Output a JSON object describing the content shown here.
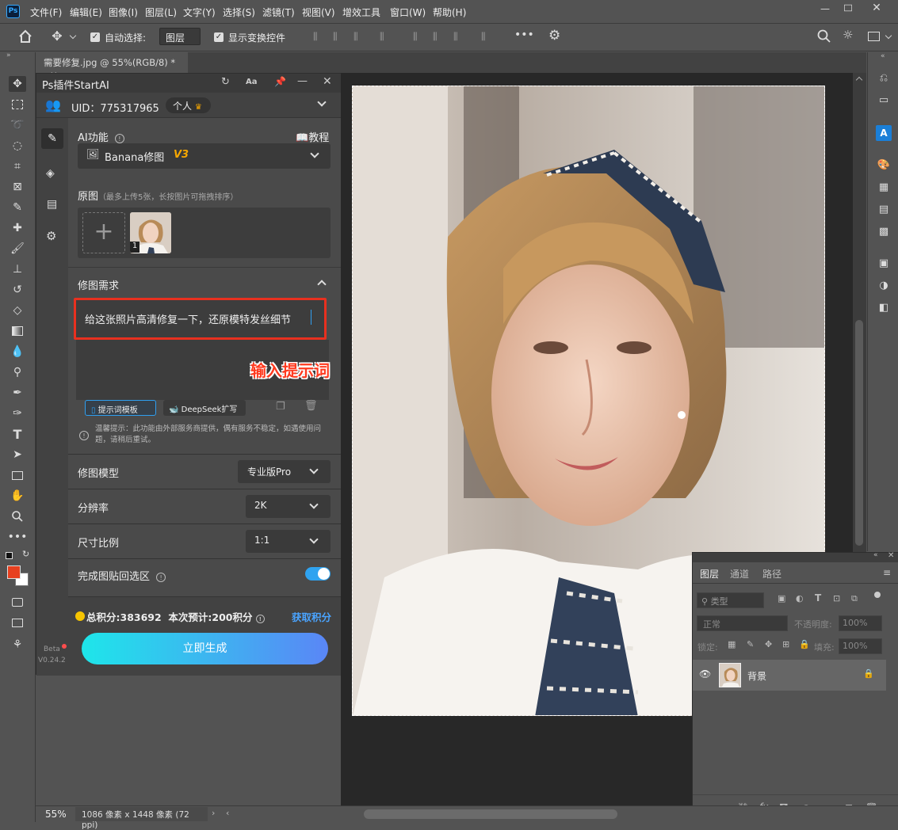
{
  "menubar": {
    "app_icon": "Ps",
    "items": [
      "文件(F)",
      "编辑(E)",
      "图像(I)",
      "图层(L)",
      "文字(Y)",
      "选择(S)",
      "滤镜(T)",
      "视图(V)",
      "增效工具",
      "窗口(W)",
      "帮助(H)"
    ]
  },
  "options": {
    "auto_select_label": "自动选择:",
    "auto_select_value": "图层",
    "show_transform_label": "显示变换控件"
  },
  "document_tab": {
    "label": "需要修复.jpg @ 55%(RGB/8) *"
  },
  "plugin": {
    "title": "Ps插件StartAI",
    "font_button": "Aa",
    "uid_label": "UID：775317965",
    "account_badge": "个人",
    "ai_feature_label": "AI功能",
    "tutorial_label": "教程",
    "feature_selected": "Banana修图",
    "feature_version": "V3",
    "source_label": "原图",
    "source_hint": "（最多上传5张，长按图片可拖拽排序）",
    "thumb_index": "1",
    "requirement_label": "修图需求",
    "prompt_text": "给这张照片高清修复一下，还原模特发丝细节",
    "annotation": "输入提示词",
    "template_button": "提示词模板",
    "deepseek_button": "DeepSeek扩写",
    "tip_text": "温馨提示：此功能由外部服务商提供，偶有服务不稳定，如遇使用问题，请稍后重试。",
    "model_label": "修图模型",
    "model_value": "专业版Pro",
    "resolution_label": "分辨率",
    "resolution_value": "2K",
    "ratio_label": "尺寸比例",
    "ratio_value": "1:1",
    "paste_back_label": "完成图贴回选区",
    "paste_back_on": true,
    "points_text": "总积分:383692",
    "estimate_text": "本次预计:200积分",
    "get_points": "获取积分",
    "generate_button": "立即生成",
    "beta_label": "Beta",
    "version_label": "V0.24.2"
  },
  "layers_panel": {
    "tabs": [
      "图层",
      "通道",
      "路径"
    ],
    "filter_placeholder": "类型",
    "blend_mode": "正常",
    "opacity_label": "不透明度:",
    "opacity_value": "100%",
    "lock_label": "锁定:",
    "fill_label": "填充:",
    "fill_value": "100%",
    "layer_name": "背景"
  },
  "status": {
    "zoom": "55%",
    "doc_info": "1086 像素 x 1448 像素 (72 ppi)"
  },
  "colors": {
    "foreground": "#e8401f",
    "background": "#ffffff",
    "highlight_red": "#e8301f",
    "gradient_start": "#1ee6ea",
    "gradient_end": "#5a86f6",
    "accent_blue": "#2f9ff0",
    "points_link": "#4aa4ff"
  }
}
